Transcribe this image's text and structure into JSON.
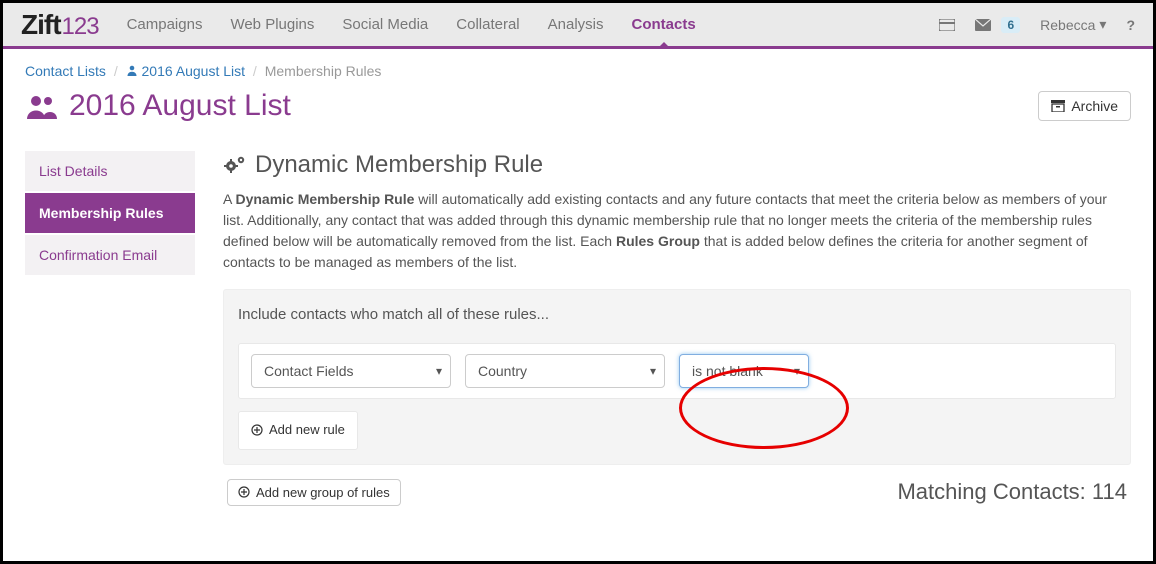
{
  "logo": {
    "prefix": "Zift",
    "suffix": "123"
  },
  "nav": {
    "items": [
      "Campaigns",
      "Web Plugins",
      "Social Media",
      "Collateral",
      "Analysis",
      "Contacts"
    ],
    "active_index": 5
  },
  "topright": {
    "mail_badge": "6",
    "user_name": "Rebecca"
  },
  "breadcrumbs": {
    "root": "Contact Lists",
    "list_name": "2016 August List",
    "current": "Membership Rules"
  },
  "page": {
    "title": "2016 August List",
    "archive_label": "Archive"
  },
  "sidebar": {
    "items": [
      "List Details",
      "Membership Rules",
      "Confirmation Email"
    ],
    "active_index": 1
  },
  "section": {
    "title": "Dynamic Membership Rule",
    "desc_pre": "A ",
    "desc_bold1": "Dynamic Membership Rule",
    "desc_mid": " will automatically add existing contacts and any future contacts that meet the criteria below as members of your list. Additionally, any contact that was added through this dynamic membership rule that no longer meets the criteria of the membership rules defined below will be automatically removed from the list. Each ",
    "desc_bold2": "Rules Group",
    "desc_post": " that is added below defines the criteria for another segment of contacts to be managed as members of the list."
  },
  "rules": {
    "heading": "Include contacts who match all of these rules...",
    "field_select": "Contact Fields",
    "attr_select": "Country",
    "op_select": "is not blank",
    "add_rule_label": "Add new rule",
    "add_group_label": "Add new group of rules"
  },
  "footer": {
    "match_label": "Matching Contacts: ",
    "match_count": "114"
  }
}
